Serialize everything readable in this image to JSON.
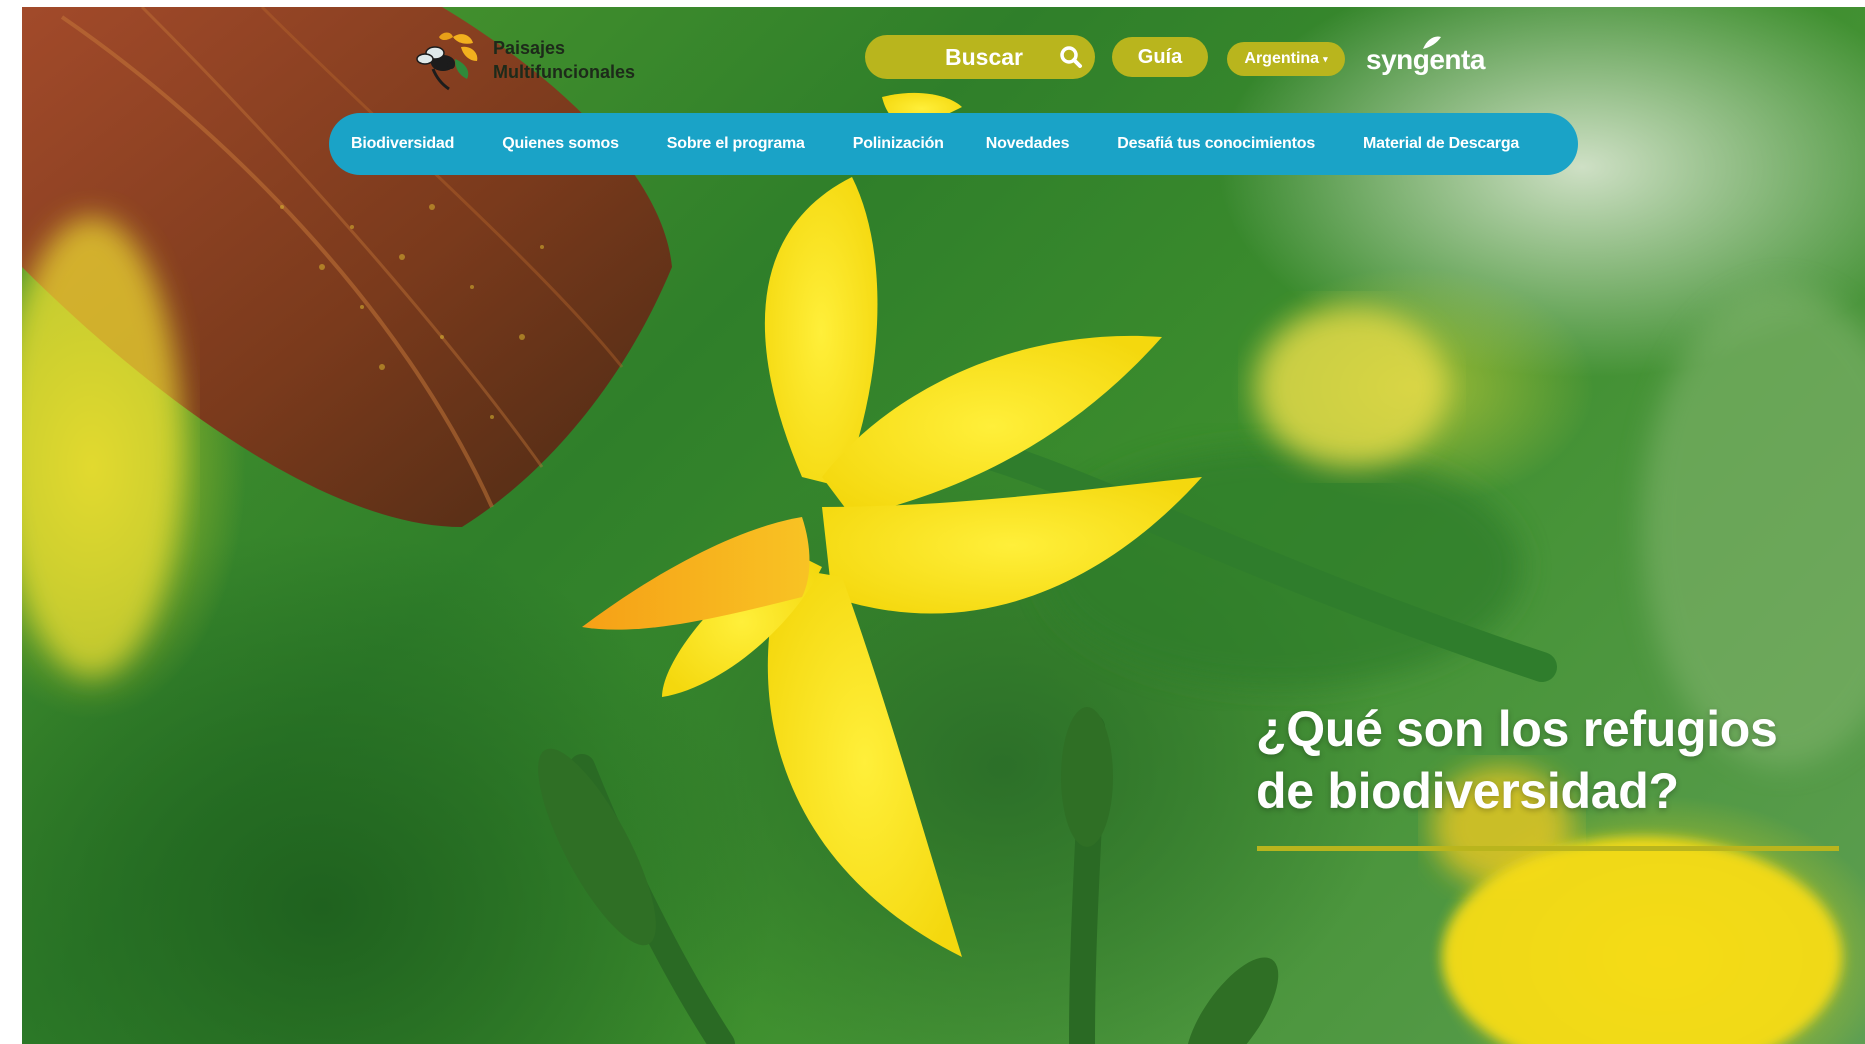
{
  "brand": {
    "name_line1": "Paisajes",
    "name_line2": "Multifuncionales",
    "logo_icon": "bee-flower-logo"
  },
  "header": {
    "search_label": "Buscar",
    "search_icon": "search-icon",
    "guide_label": "Guía",
    "country_label": "Argentina",
    "country_caret": "▾",
    "partner_logo": "syngenta"
  },
  "nav": {
    "items": [
      {
        "label": "Biodiversidad"
      },
      {
        "label": "Quienes somos"
      },
      {
        "label": "Sobre el programa"
      },
      {
        "label": "Polinización"
      },
      {
        "label": "Novedades"
      },
      {
        "label": "Desafiá tus conocimientos"
      },
      {
        "label": "Material de Descarga"
      }
    ]
  },
  "hero": {
    "headline_line1": "¿Qué son los refugios",
    "headline_line2": "de biodiversidad?"
  },
  "colors": {
    "accent_olive": "#b9b51d",
    "nav_blue": "#1aa3c7",
    "text_white": "#ffffff"
  }
}
